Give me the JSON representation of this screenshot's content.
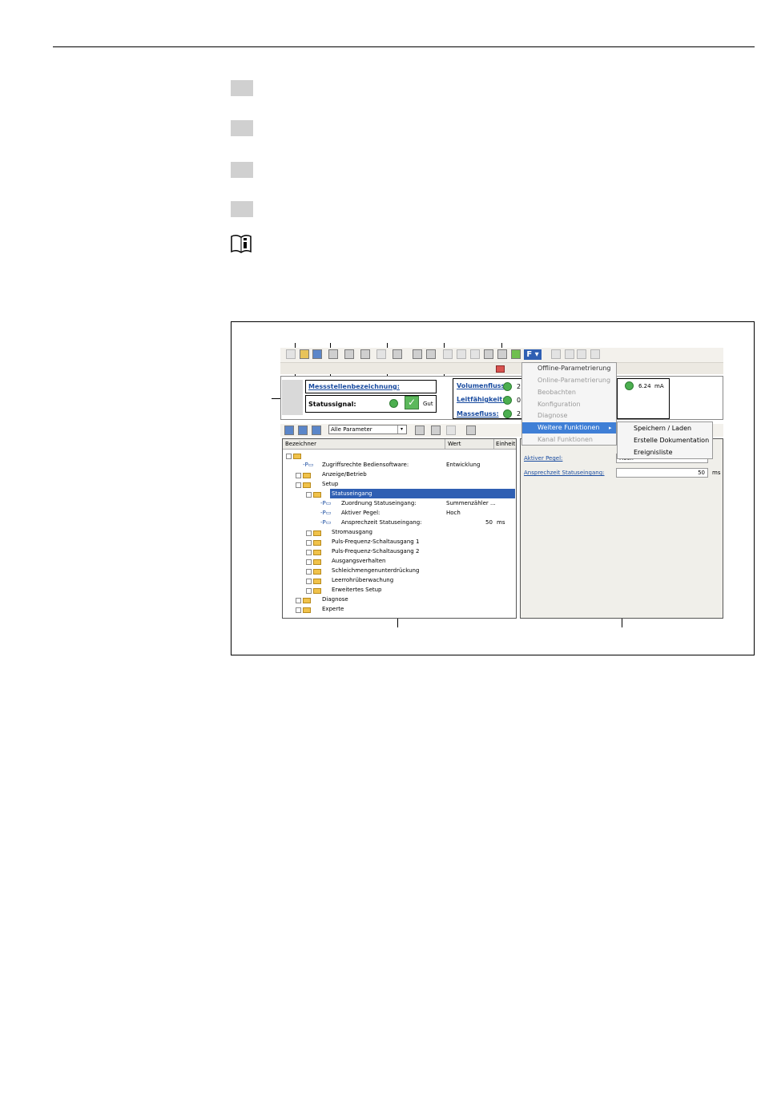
{
  "menu": {
    "items": [
      {
        "label": "Offline-Parametrierung",
        "enabled": true
      },
      {
        "label": "Online-Parametrierung",
        "enabled": false
      },
      {
        "label": "Beobachten",
        "enabled": false
      },
      {
        "label": "Konfiguration",
        "enabled": false
      },
      {
        "label": "Diagnose",
        "enabled": false
      },
      {
        "label": "Weitere Funktionen",
        "enabled": true,
        "selected": true
      },
      {
        "label": "Kanal Funktionen",
        "enabled": false
      }
    ],
    "submenu": [
      "Speichern / Laden",
      "Erstelle Dokumentation",
      "Ereignisliste"
    ]
  },
  "toolbar": {
    "f_button": "F"
  },
  "header": {
    "tag_label": "Messstellenbezeichnung:",
    "status_label": "Statussignal:",
    "status_value": "Gut",
    "measurements": [
      {
        "label": "Volumenfluss:",
        "value": "2"
      },
      {
        "label": "Leitfähigkeit:",
        "value": "0"
      },
      {
        "label": "Massefluss:",
        "value": "2"
      }
    ],
    "current_value": "6.24",
    "current_unit": "mA"
  },
  "filter": {
    "selected": "Alle Parameter"
  },
  "tree": {
    "columns": [
      "Bezeichner",
      "Wert",
      "Einheit"
    ],
    "rows": [
      {
        "label": "Zugriffsrechte Bediensoftware:",
        "value": "Entwicklung",
        "unit": ""
      },
      {
        "label": "Anzeige/Betrieb",
        "value": "",
        "unit": ""
      },
      {
        "label": "Setup",
        "value": "",
        "unit": ""
      },
      {
        "label": "Statuseingang",
        "value": "",
        "unit": ""
      },
      {
        "label": "Zuordnung Statuseingang:",
        "value": "Summenzähler ...",
        "unit": ""
      },
      {
        "label": "Aktiver Pegel:",
        "value": "Hoch",
        "unit": ""
      },
      {
        "label": "Ansprechzeit Statuseingang:",
        "value": "50",
        "unit": "ms"
      },
      {
        "label": "Stromausgang",
        "value": "",
        "unit": ""
      },
      {
        "label": "Puls-Frequenz-Schaltausgang 1",
        "value": "",
        "unit": ""
      },
      {
        "label": "Puls-Frequenz-Schaltausgang 2",
        "value": "",
        "unit": ""
      },
      {
        "label": "Ausgangsverhalten",
        "value": "",
        "unit": ""
      },
      {
        "label": "Schleichmengenunterdrückung",
        "value": "",
        "unit": ""
      },
      {
        "label": "Leerrohrüberwachung",
        "value": "",
        "unit": ""
      },
      {
        "label": "Erweitertes Setup",
        "value": "",
        "unit": ""
      },
      {
        "label": "Diagnose",
        "value": "",
        "unit": ""
      },
      {
        "label": "Experte",
        "value": "",
        "unit": ""
      }
    ]
  },
  "detail": {
    "field1_label": "Aktiver Pegel:",
    "field1_value": "Hoch",
    "field2_label": "Ansprechzeit Statuseingang:",
    "field2_value": "50",
    "field2_unit": "ms"
  },
  "colors": {
    "selection": "#2f5fb3",
    "menu_highlight": "#3f7fd6",
    "link": "#1a4ca0"
  }
}
